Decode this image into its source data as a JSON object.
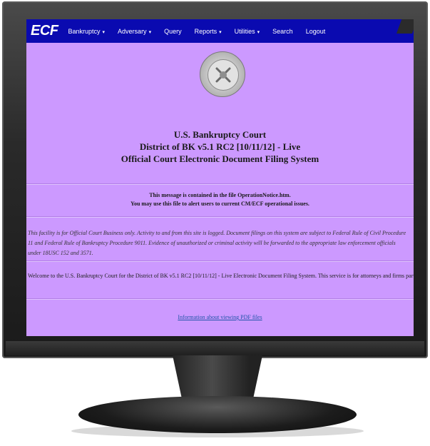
{
  "nav": {
    "logo": "ECF",
    "items": [
      {
        "label": "Bankruptcy",
        "caret": "▾"
      },
      {
        "label": "Adversary",
        "caret": "▾"
      },
      {
        "label": "Query",
        "caret": ""
      },
      {
        "label": "Reports",
        "caret": "▾"
      },
      {
        "label": "Utilities",
        "caret": "▾"
      },
      {
        "label": "Search",
        "caret": ""
      },
      {
        "label": "Logout",
        "caret": ""
      }
    ]
  },
  "header": {
    "line1": "U.S. Bankruptcy Court",
    "line2": "District of BK v5.1 RC2 [10/11/12] - Live",
    "line3": "Official Court Electronic Document Filing System"
  },
  "notice": {
    "line1": "This message is contained in the file OperationNotice.htm.",
    "line2": "You may use this file to alert users to current CM/ECF operational issues."
  },
  "warning": "This facility is for Official Court Business only. Activity to and from this site is logged. Document filings on this system are subject to Federal Rule of Civil Procedure 11 and Federal Rule of Bankruptcy Procedure 9011. Evidence of unauthorized or criminal activity will be forwarded to the appropriate law enforcement officials under 18USC 152 and 3571.",
  "welcome": "Welcome to the U.S. Bankruptcy Court for the District of BK v5.1 RC2 [10/11/12] - Live Electronic Document Filing System. This service is for attorneys and firms participating in the electronic filing system.",
  "pdf_link": "Information about viewing PDF files",
  "colors": {
    "screen_bg": "#cc99ff",
    "nav_bg": "#0a0ab0",
    "link": "#2255aa"
  }
}
